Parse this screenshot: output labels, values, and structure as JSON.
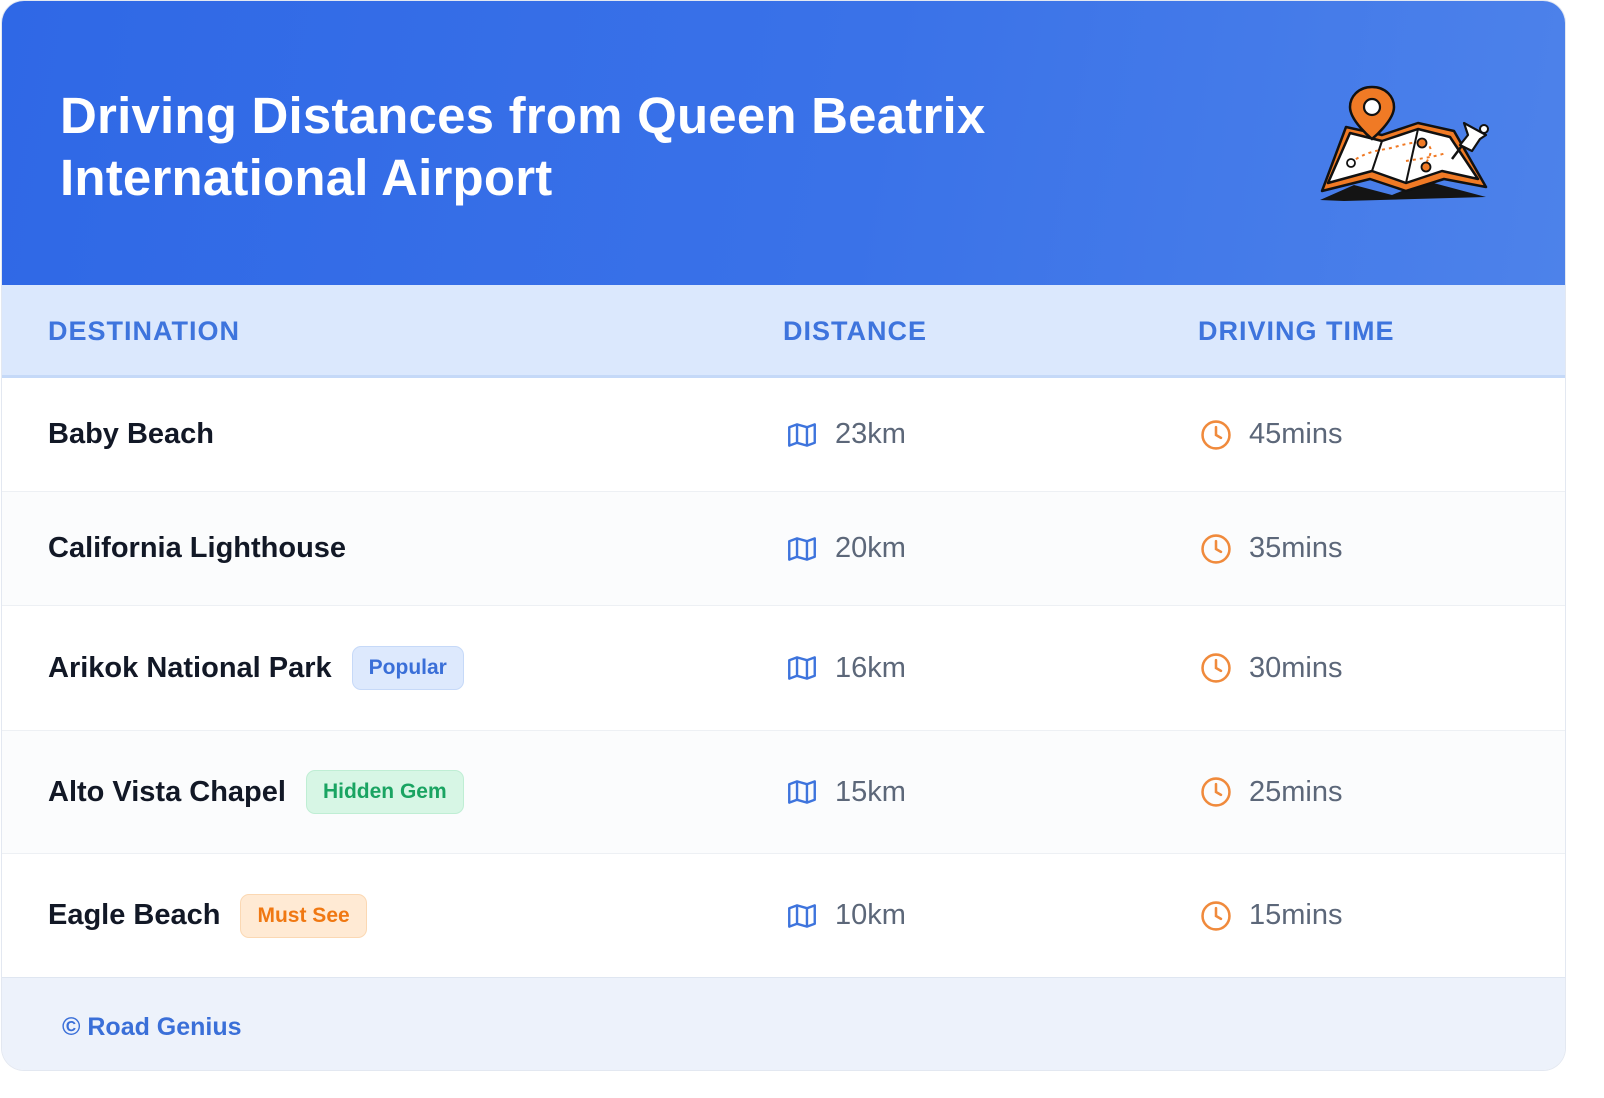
{
  "header": {
    "title_line1": "Driving Distances from Queen Beatrix",
    "title_line2": "International Airport",
    "illustration": "map-with-pins-icon"
  },
  "table": {
    "columns": [
      "DESTINATION",
      "DISTANCE",
      "DRIVING TIME"
    ],
    "rows": [
      {
        "destination": "Baby Beach",
        "badge": "",
        "distance": "23km",
        "time": "45mins"
      },
      {
        "destination": "California Lighthouse",
        "badge": "",
        "distance": "20km",
        "time": "35mins"
      },
      {
        "destination": "Arikok National Park",
        "badge": "Popular",
        "badge_style": "blue",
        "distance": "16km",
        "time": "30mins"
      },
      {
        "destination": "Alto Vista Chapel",
        "badge": "Hidden Gem",
        "badge_style": "green",
        "distance": "15km",
        "time": "25mins"
      },
      {
        "destination": "Eagle Beach",
        "badge": "Must See",
        "badge_style": "orange",
        "distance": "10km",
        "time": "15mins"
      }
    ]
  },
  "footer": {
    "credit": "© Road Genius"
  },
  "colors": {
    "header_gradient_start": "#2f68e6",
    "header_gradient_end": "#4d82ea",
    "column_header_text": "#3e74dd",
    "column_header_bg": "#dbe8fd",
    "distance_icon": "#3e74dd",
    "clock_icon": "#f08a3c",
    "badge_popular": "#3a6fd8",
    "badge_hidden_gem": "#1aa462",
    "badge_must_see": "#f07812"
  },
  "icons": {
    "distance": "map-icon",
    "time": "clock-icon"
  }
}
